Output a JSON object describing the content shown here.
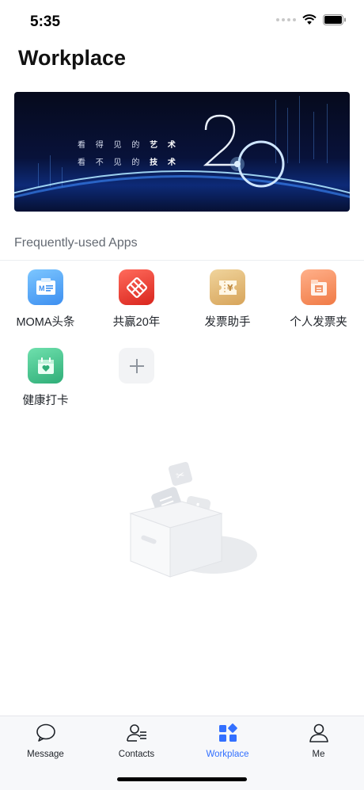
{
  "status_bar": {
    "time": "5:35"
  },
  "header": {
    "title": "Workplace"
  },
  "banner": {
    "line1_normal": "看 得 见 的 ",
    "line1_bold": "艺 术",
    "line2_normal": "看 不 见 的 ",
    "line2_bold": "技 术",
    "number": "20"
  },
  "section": {
    "title": "Frequently-used Apps"
  },
  "apps": [
    {
      "label": "MOMA头条",
      "icon": "moma-news-icon",
      "color": "#4fa8f5"
    },
    {
      "label": "共赢20年",
      "icon": "win-together-icon",
      "color": "#e8403a"
    },
    {
      "label": "发票助手",
      "icon": "invoice-assistant-icon",
      "color": "#dfb06a"
    },
    {
      "label": "个人发票夹",
      "icon": "invoice-folder-icon",
      "color": "#f58b5a"
    },
    {
      "label": "健康打卡",
      "icon": "health-checkin-icon",
      "color": "#3fbf8a"
    },
    {
      "label": "",
      "icon": "add-icon",
      "color": "#f2f3f5"
    }
  ],
  "tabs": [
    {
      "label": "Message",
      "icon": "message-icon",
      "active": false
    },
    {
      "label": "Contacts",
      "icon": "contacts-icon",
      "active": false
    },
    {
      "label": "Workplace",
      "icon": "workplace-icon",
      "active": true
    },
    {
      "label": "Me",
      "icon": "me-icon",
      "active": false
    }
  ],
  "colors": {
    "accent": "#3370ff",
    "text": "#1f2329",
    "muted": "#646a73"
  }
}
